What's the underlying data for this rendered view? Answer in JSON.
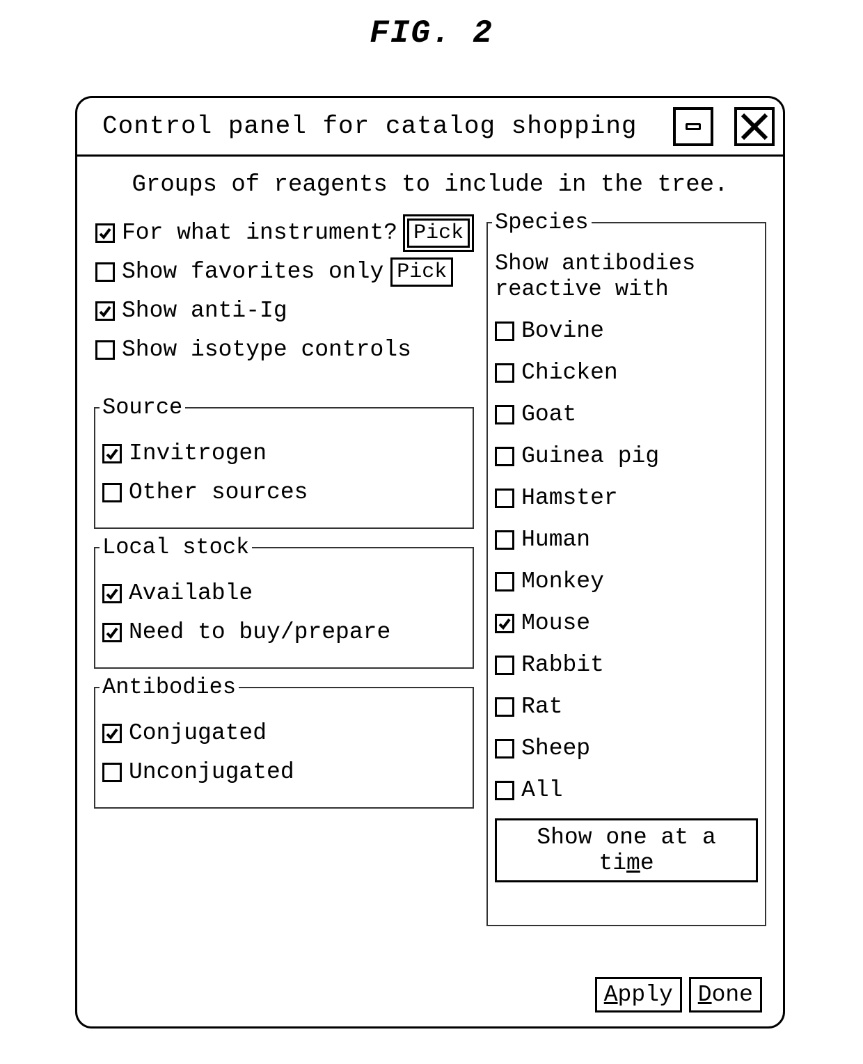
{
  "figure_label": "FIG. 2",
  "window": {
    "title": "Control panel for catalog shopping",
    "subtitle": "Groups of reagents to include in the tree."
  },
  "top_options": [
    {
      "label": "For what instrument?",
      "checked": true,
      "pick": true,
      "pick_double": true
    },
    {
      "label": "Show favorites only",
      "checked": false,
      "pick": true,
      "pick_double": false
    },
    {
      "label": "Show anti-Ig",
      "checked": true,
      "pick": false
    },
    {
      "label": "Show isotype controls",
      "checked": false,
      "pick": false
    }
  ],
  "pick_label": "Pick",
  "source": {
    "legend": "Source",
    "items": [
      {
        "label": "Invitrogen",
        "checked": true
      },
      {
        "label": "Other sources",
        "checked": false
      }
    ]
  },
  "local_stock": {
    "legend": "Local stock",
    "items": [
      {
        "label": "Available",
        "checked": true
      },
      {
        "label": "Need to buy/prepare",
        "checked": true
      }
    ]
  },
  "antibodies": {
    "legend": "Antibodies",
    "items": [
      {
        "label": "Conjugated",
        "checked": true
      },
      {
        "label": "Unconjugated",
        "checked": false
      }
    ]
  },
  "species": {
    "legend": "Species",
    "instruction": "Show antibodies reactive with",
    "items": [
      {
        "label": "Bovine",
        "checked": false
      },
      {
        "label": "Chicken",
        "checked": false
      },
      {
        "label": "Goat",
        "checked": false
      },
      {
        "label": "Guinea pig",
        "checked": false
      },
      {
        "label": "Hamster",
        "checked": false
      },
      {
        "label": "Human",
        "checked": false
      },
      {
        "label": "Monkey",
        "checked": false
      },
      {
        "label": "Mouse",
        "checked": true
      },
      {
        "label": "Rabbit",
        "checked": false
      },
      {
        "label": "Rat",
        "checked": false
      },
      {
        "label": "Sheep",
        "checked": false
      },
      {
        "label": "All",
        "checked": false
      }
    ],
    "show_one_prefix": "Show one at a ti",
    "show_one_mn": "m",
    "show_one_suffix": "e"
  },
  "footer": {
    "apply_mn": "A",
    "apply_rest": "pply",
    "done_mn": "D",
    "done_rest": "one"
  }
}
